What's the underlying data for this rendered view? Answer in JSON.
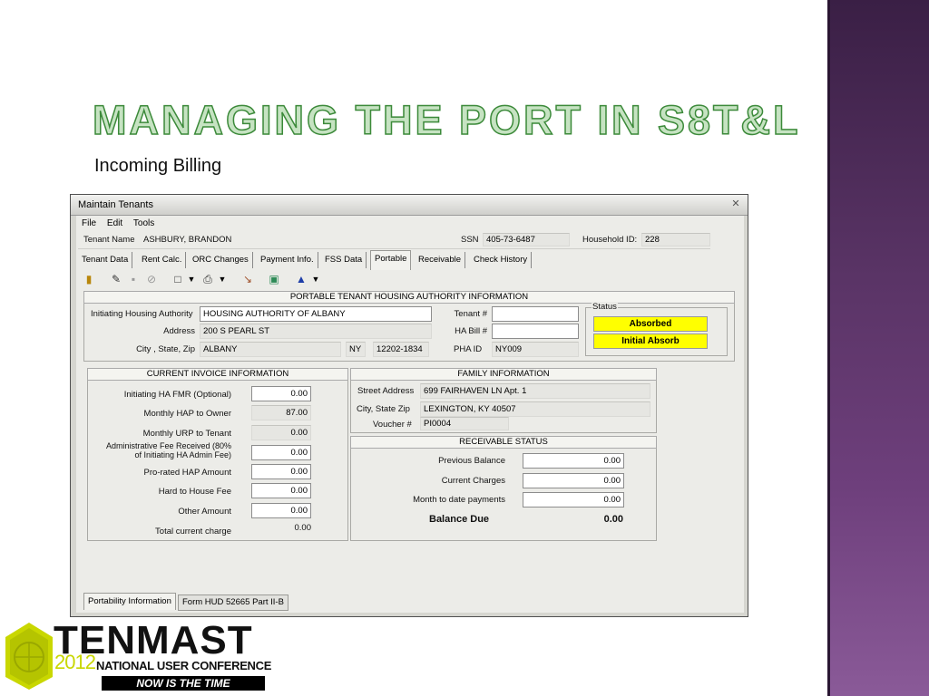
{
  "slide": {
    "title": "MANAGING THE PORT IN S8T&L",
    "subtitle": "Incoming Billing"
  },
  "window": {
    "title": "Maintain Tenants",
    "menu": [
      "File",
      "Edit",
      "Tools"
    ],
    "tenant": {
      "name_label": "Tenant Name",
      "name": "ASHBURY, BRANDON",
      "ssn_label": "SSN",
      "ssn": "405-73-6487",
      "household_label": "Household ID:",
      "household": "228"
    },
    "tabs": [
      "Tenant Data",
      "Rent Calc.",
      "ORC Changes",
      "Payment Info.",
      "FSS Data",
      "Portable",
      "Receivable",
      "Check History"
    ],
    "active_tab": "Portable",
    "toolbar_icons": [
      "door-exit-icon",
      "edit-pencil-icon",
      "save-disk-icon",
      "cancel-icon",
      "new-document-icon",
      "dropdown-arrow-icon",
      "print-icon",
      "dropdown-arrow-icon",
      "wand-icon",
      "screen-icon",
      "user-icon",
      "dropdown-arrow-icon"
    ],
    "pha_section": {
      "header": "PORTABLE TENANT HOUSING AUTHORITY INFORMATION",
      "initiating_label": "Initiating Housing Authority",
      "initiating_value": "HOUSING AUTHORITY OF ALBANY",
      "address_label": "Address",
      "address_value": "200 S PEARL ST",
      "city_label": "City , State, Zip",
      "city_value": "ALBANY",
      "state_value": "NY",
      "zip_value": "12202-1834",
      "tenant_no_label": "Tenant #",
      "tenant_no_value": "",
      "ha_bill_label": "HA Bill #",
      "ha_bill_value": "",
      "pha_id_label": "PHA ID",
      "pha_id_value": "NY009",
      "status_label": "Status",
      "status_absorbed": "Absorbed",
      "status_initial": "Initial Absorb"
    },
    "invoice": {
      "header": "CURRENT INVOICE INFORMATION",
      "rows": [
        {
          "label": "Initiating HA FMR (Optional)",
          "value": "0.00"
        },
        {
          "label": "Monthly HAP to Owner",
          "value": "87.00"
        },
        {
          "label": "Monthly URP to Tenant",
          "value": "0.00"
        },
        {
          "label": "Administrative Fee Received (80% of Initiating HA Admin Fee)",
          "label_line1": "Administrative Fee Received (80%",
          "label_line2": "of Initiating HA Admin Fee)",
          "value": "0.00"
        },
        {
          "label": "Pro-rated HAP Amount",
          "value": "0.00"
        },
        {
          "label": "Hard to House Fee",
          "value": "0.00"
        },
        {
          "label": "Other Amount",
          "value": "0.00"
        },
        {
          "label": "Total current charge",
          "value": "0.00"
        }
      ]
    },
    "family": {
      "header": "FAMILY INFORMATION",
      "street_label": "Street Address",
      "street_value": "699 FAIRHAVEN LN Apt. 1",
      "city_label": "City, State  Zip",
      "city_value": "LEXINGTON, KY 40507",
      "voucher_label": "Voucher #",
      "voucher_value": "PI0004"
    },
    "receivable": {
      "header": "RECEIVABLE STATUS",
      "previous_label": "Previous Balance",
      "previous_value": "0.00",
      "current_label": "Current Charges",
      "current_value": "0.00",
      "mtd_label": "Month to date payments",
      "mtd_value": "0.00",
      "balance_label": "Balance Due",
      "balance_value": "0.00"
    },
    "bottom_tabs": [
      "Portability Information",
      "Form HUD 52665 Part II-B"
    ]
  },
  "logo": {
    "word": "TENMAST",
    "year": "2012",
    "conference": "NATIONAL USER CONFERENCE",
    "tagline": "NOW IS THE TIME",
    "accent": "#c9d700"
  },
  "colors": {
    "title_fill": "#c6e3c2",
    "title_stroke": "#3c8a3a",
    "side_band": "#5a3466",
    "status_yellow": "#ffff00"
  }
}
